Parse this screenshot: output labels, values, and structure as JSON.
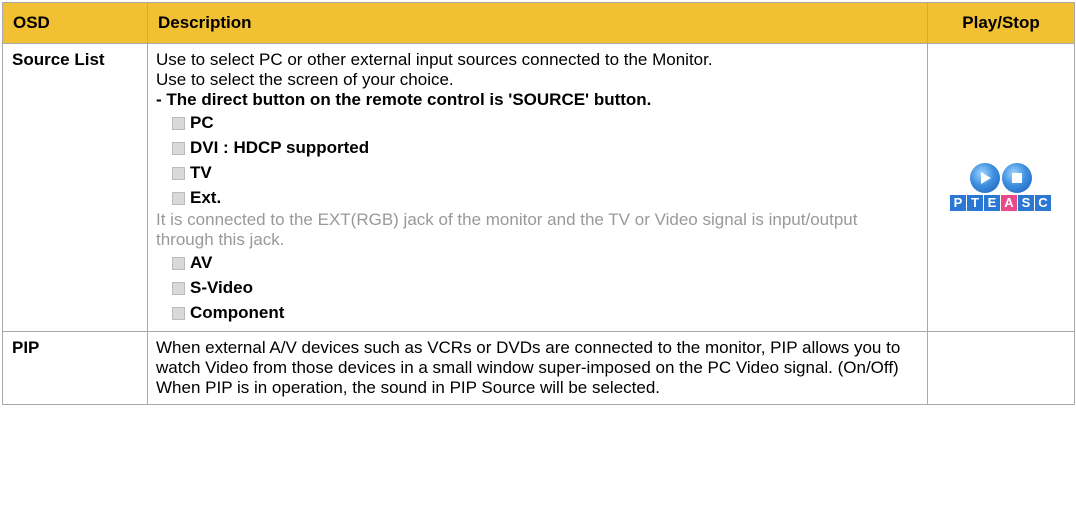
{
  "header": {
    "osd": "OSD",
    "description": "Description",
    "play_stop": "Play/Stop"
  },
  "rows": [
    {
      "osd": "Source List",
      "lines": [
        "Use to select PC or other external input sources connected to the Monitor.",
        "Use to select the screen of your choice."
      ],
      "note": "- The direct button on the remote control is 'SOURCE' button.",
      "items": [
        "PC",
        "DVI : HDCP supported",
        "TV",
        "Ext."
      ],
      "ext_desc": "It is connected to the EXT(RGB) jack of the monitor and the TV or Video signal is input/output through this jack.",
      "items2": [
        "AV",
        "S-Video",
        "Component"
      ],
      "ps_letters": [
        "P",
        "T",
        "E",
        "A",
        "S",
        "C"
      ]
    },
    {
      "osd": "PIP",
      "text": "When external A/V devices such as VCRs or DVDs are connected to the monitor, PIP allows you to watch Video from those devices in a small window super-imposed on the PC Video signal. (On/Off)",
      "text2": "When PIP is in operation, the sound in PIP Source will be selected."
    }
  ],
  "colors": {
    "header_bg": "#f2c033",
    "border": "#a9a9a9",
    "gray_text": "#999999",
    "icon_blue": "#2a78d4"
  }
}
